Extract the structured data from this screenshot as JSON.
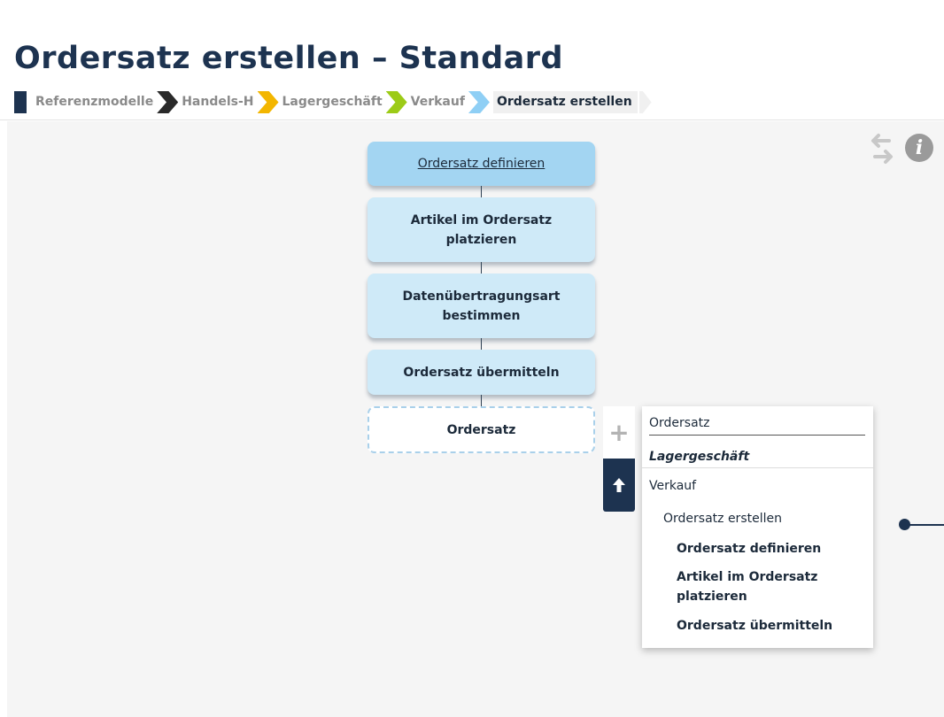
{
  "page": {
    "title": "Ordersatz erstellen – Standard"
  },
  "breadcrumb": {
    "items": [
      "Referenzmodelle",
      "Handels-H",
      "Lagergeschäft",
      "Verkauf"
    ],
    "current": "Ordersatz erstellen"
  },
  "toolbar": {
    "history_icon": "undo-redo-icon",
    "info_icon": "info-icon",
    "info_glyph": "i"
  },
  "process": {
    "steps": [
      {
        "label": "Ordersatz definieren",
        "active": true
      },
      {
        "label": "Artikel im Ordersatz platzieren",
        "active": false
      },
      {
        "label": "Datenübertragungsart bestimmen",
        "active": false
      },
      {
        "label": "Ordersatz übermitteln",
        "active": false
      }
    ],
    "object": "Ordersatz"
  },
  "side_buttons": {
    "add_glyph": "+",
    "add_icon": "plus-icon",
    "up_icon": "arrow-up-icon"
  },
  "dropdown": {
    "input_value": "Ordersatz",
    "category": "Lagergeschäft",
    "level1": "Verkauf",
    "level2": "Ordersatz erstellen",
    "items": [
      "Ordersatz definieren",
      "Artikel im Ordersatz platzieren",
      "Ordersatz übermitteln"
    ]
  },
  "colors": {
    "accent": "#1d3350",
    "step": "#cfeaf8",
    "step_active": "#a3d5f2",
    "dashed": "#a9d0ea"
  }
}
